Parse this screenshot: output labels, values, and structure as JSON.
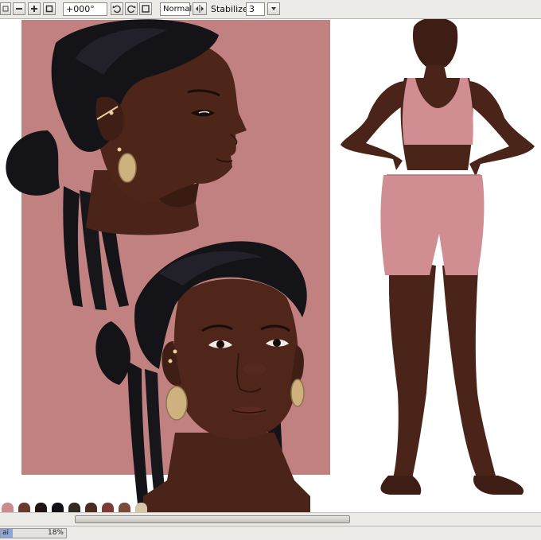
{
  "toolbar": {
    "buttons": [
      {
        "name": "zoom-out",
        "icon": "minus-icon"
      },
      {
        "name": "zoom-in",
        "icon": "plus-icon"
      },
      {
        "name": "zoom-reset",
        "icon": "square-icon"
      }
    ],
    "rotation_value": "+000°",
    "rotate_buttons": [
      {
        "name": "rotate-left",
        "icon": "rotate-ccw-icon"
      },
      {
        "name": "rotate-right",
        "icon": "rotate-cw-icon"
      },
      {
        "name": "rotate-reset",
        "icon": "reset-icon"
      }
    ],
    "blend_mode": "Normal",
    "flip_icon": "flip-horizontal-icon",
    "stabilizer_label": "Stabilizer",
    "stabilizer_value": "3",
    "stabilizer_dropdown_icon": "chevron-down-icon"
  },
  "palette": {
    "swatches": [
      "#c98d8d",
      "#6a3a2c",
      "#201512",
      "#101016",
      "#2f2a24",
      "#4d2a22",
      "#7d3b36",
      "#7a4a3a",
      "#d8c6a8"
    ]
  },
  "colors": {
    "canvas_bg": "#ffffff",
    "backdrop_pink": "#c28181",
    "skin": "#4a2418",
    "hair": "#141318",
    "clothing_pink": "#d08e92",
    "earring_gold": "#cfb180"
  },
  "status": {
    "document_name": "ai",
    "progress_text": "18%",
    "progress_fraction": 0.18
  }
}
